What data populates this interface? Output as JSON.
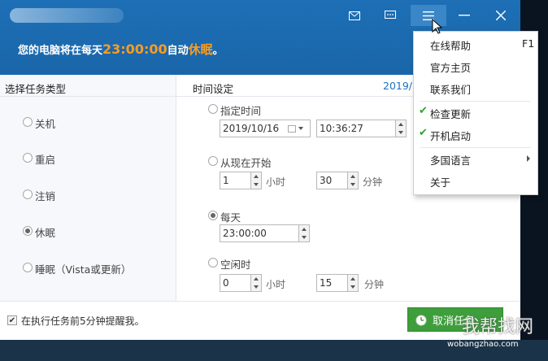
{
  "titlebar": {
    "notice_prefix": "您的电脑将在每天",
    "notice_time": "23:00:00",
    "notice_mid": "自动",
    "notice_action": "休眠",
    "notice_suffix": "。",
    "buttons": [
      "mail-icon",
      "message-icon",
      "menu-icon",
      "minimize-icon",
      "close-icon"
    ]
  },
  "left": {
    "title": "选择任务类型",
    "options": [
      {
        "label": "关机",
        "checked": false
      },
      {
        "label": "重启",
        "checked": false
      },
      {
        "label": "注销",
        "checked": false
      },
      {
        "label": "休眠",
        "checked": true
      },
      {
        "label": "睡眠（Vista或更新）",
        "checked": false
      }
    ]
  },
  "right": {
    "title": "时间设定",
    "date_peek": "2019/1",
    "specified": {
      "label": "指定时间",
      "date": "2019/10/16",
      "time": "10:36:27",
      "checked": false
    },
    "from_now": {
      "label": "从现在开始",
      "hours": "1",
      "hour_unit": "小时",
      "minutes": "30",
      "minute_unit": "分钟",
      "checked": false
    },
    "daily": {
      "label": "每天",
      "time": "23:00:00",
      "checked": true
    },
    "idle": {
      "label": "空闲时",
      "hours": "0",
      "hour_unit": "小时",
      "minutes": "15",
      "minute_unit": "分钟",
      "checked": false
    }
  },
  "bottom": {
    "remind_label": "在执行任务前5分钟提醒我。",
    "remind_checked": true,
    "cancel_label": "取消任务"
  },
  "menu": {
    "items": [
      {
        "label": "在线帮助",
        "shortcut": "F1",
        "checked": false
      },
      {
        "label": "官方主页",
        "checked": false
      },
      {
        "label": "联系我们",
        "checked": false
      },
      {
        "label": "检查更新",
        "checked": true
      },
      {
        "label": "开机启动",
        "checked": true
      },
      {
        "label": "多国语言",
        "submenu": true
      },
      {
        "label": "关于"
      }
    ]
  },
  "watermark": {
    "text": "我帮找网",
    "url": "wobangzhao.com"
  },
  "colors": {
    "titlebar": "#1d6fb6",
    "accent_orange": "#ff9c1f",
    "check_green": "#2fa12c",
    "button_green": "#3e9e3c"
  }
}
